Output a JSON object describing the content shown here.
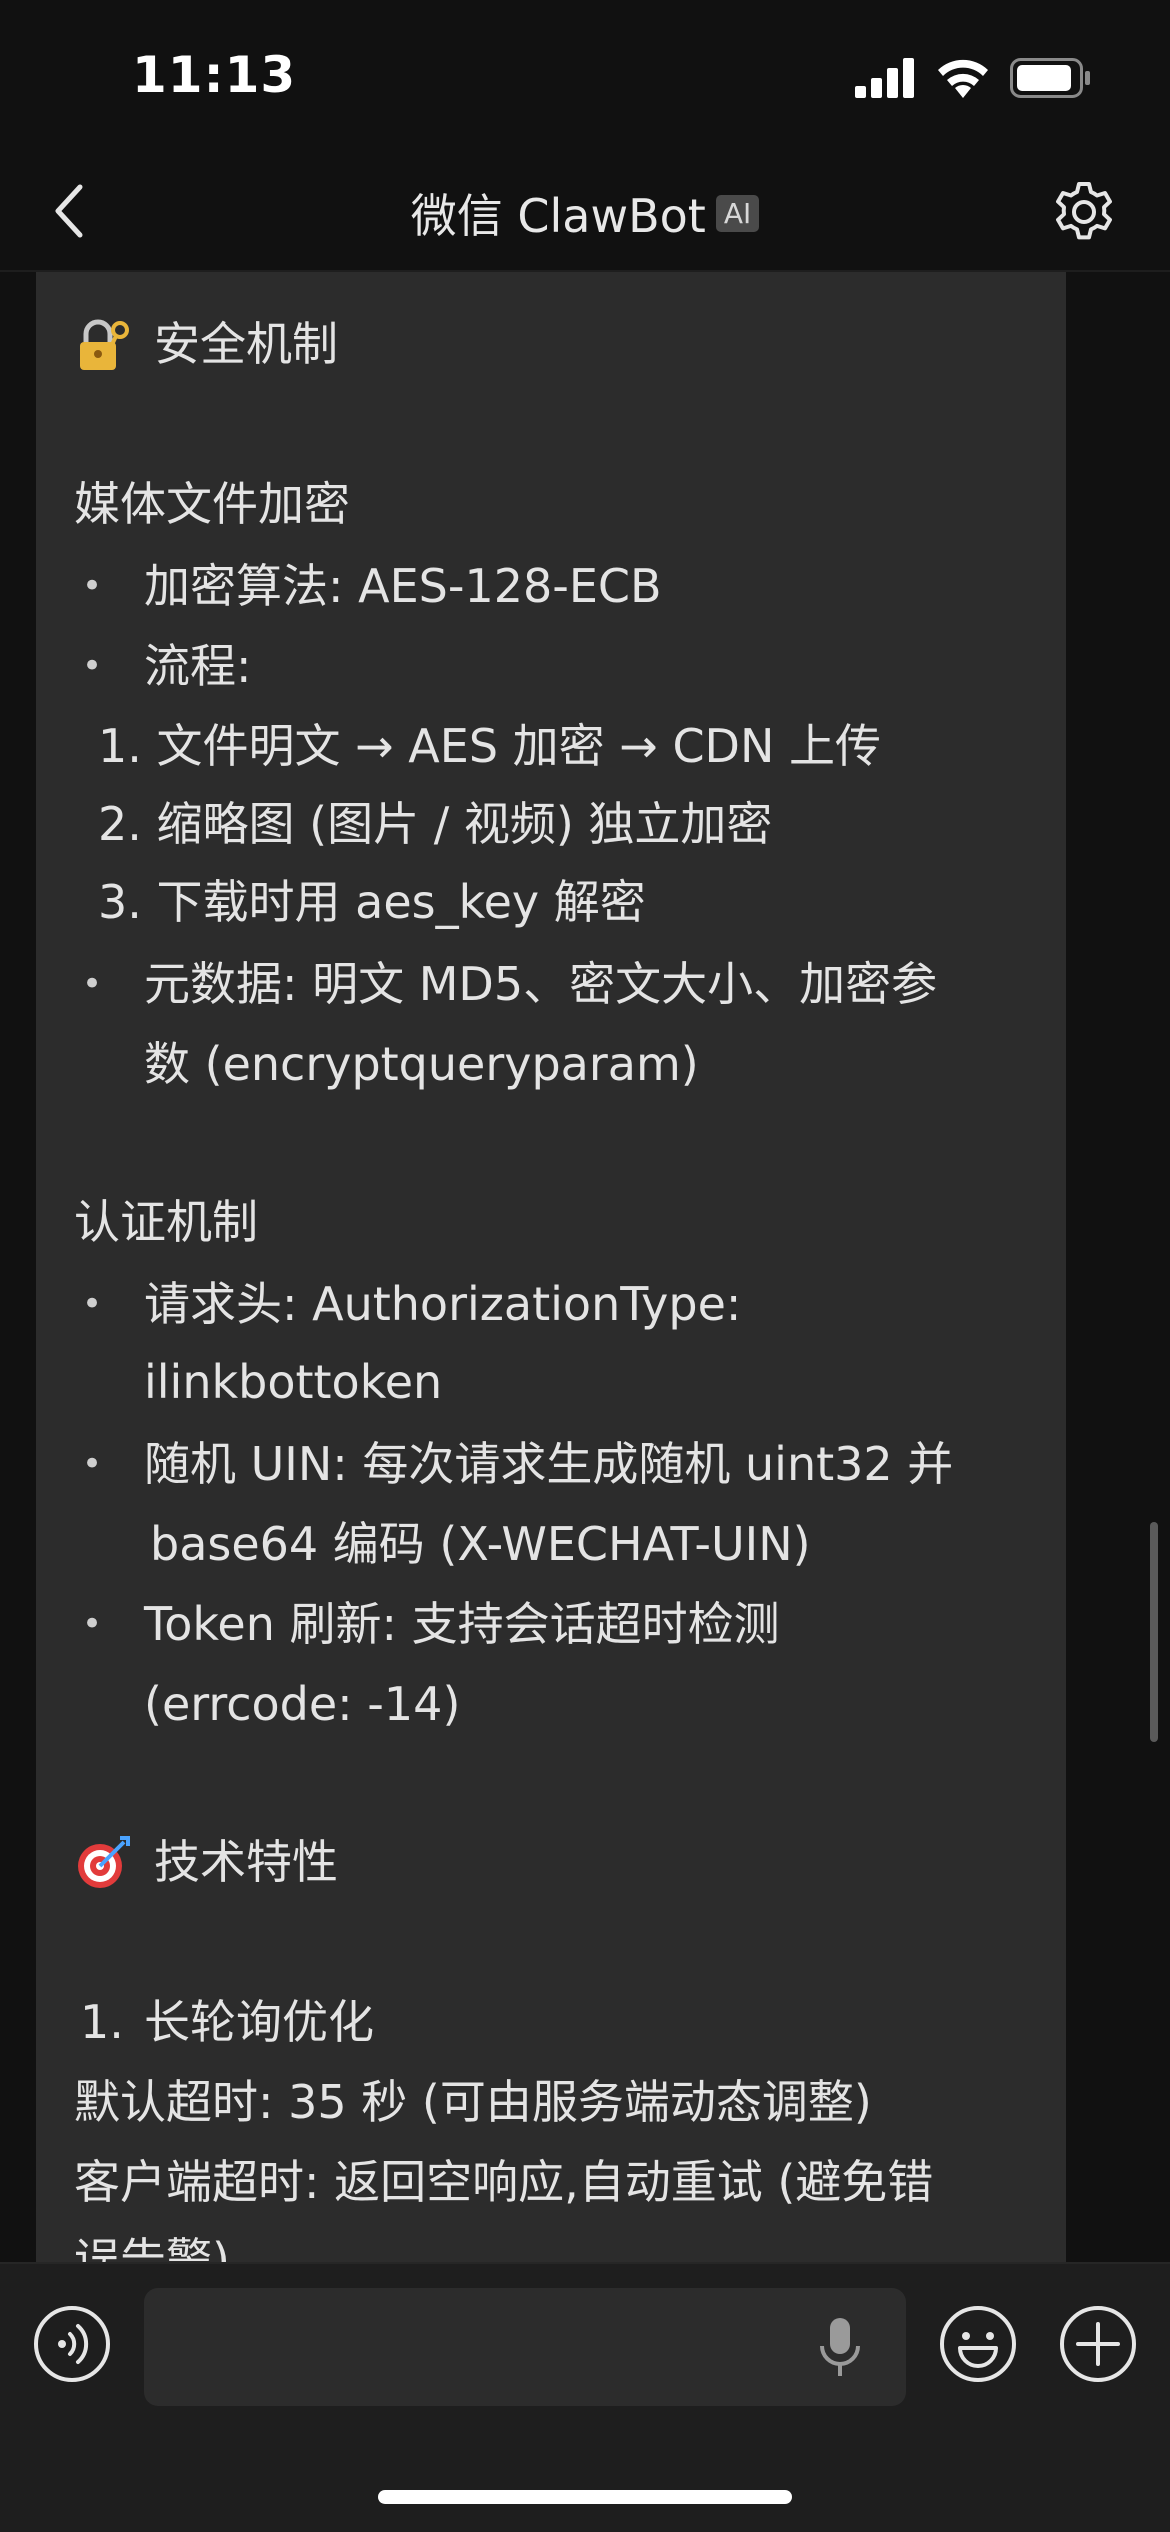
{
  "status_bar": {
    "time": "11:13"
  },
  "nav": {
    "title": "微信 ClawBot",
    "badge": "AI"
  },
  "message": {
    "security_heading": "安全机制",
    "media_title": "媒体文件加密",
    "algo": "加密算法: AES-128-ECB",
    "flow": "流程:",
    "flow_step1": "1. 文件明文 → AES 加密 → CDN 上传",
    "flow_step2": "2. 缩略图 (图片 / 视频) 独立加密",
    "flow_step3": "3. 下载时用 aes_key 解密",
    "metadata_line1": "元数据: 明文 MD5、密文大小、加密参",
    "metadata_line2": "数 (encryptqueryparam)",
    "auth_title": "认证机制",
    "header_line1": "请求头: AuthorizationType:",
    "header_line2": "ilinkbottoken",
    "uin_line1": "随机 UIN: 每次请求生成随机 uint32 并",
    "uin_line2": "base64 编码 (X-WECHAT-UIN)",
    "token_line1": "Token 刷新: 支持会话超时检测",
    "token_line2": "(errcode: -14)",
    "tech_heading": "技术特性",
    "longpoll_num": "1.",
    "longpoll_title": "长轮询优化",
    "default_timeout": "默认超时: 35 秒 (可由服务端动态调整)",
    "client_timeout_line1": "客户端超时: 返回空响应,自动重试 (避免错",
    "client_timeout_line2": "误告警)"
  },
  "input": {
    "placeholder": ""
  },
  "icons": {
    "lock": "lock-with-key-icon",
    "target": "direct-hit-target-icon",
    "back": "chevron-left-icon",
    "settings": "gear-icon",
    "voice": "voice-icon",
    "mic": "microphone-icon",
    "emoji": "smiley-face-icon",
    "plus": "plus-icon"
  },
  "colors": {
    "background": "#111111",
    "bubble": "#2c2c2c",
    "text": "#e4e4e4",
    "input_bar": "#1e1e1e"
  }
}
